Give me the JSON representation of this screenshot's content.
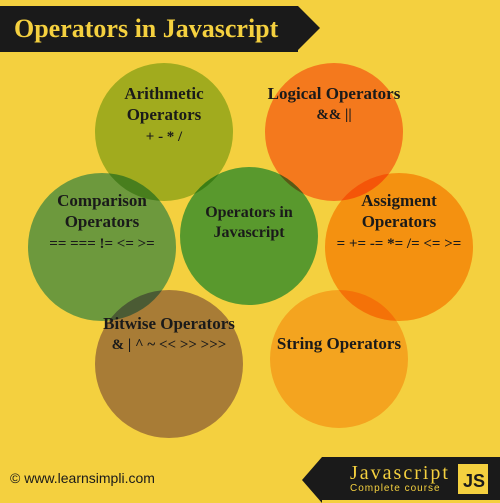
{
  "title": "Operators in Javascript",
  "circles": {
    "arithmetic": {
      "heading": "Arithmetic Operators",
      "ops": "+  -  *  /"
    },
    "logical": {
      "heading": "Logical Operators",
      "ops": "&&  ||"
    },
    "comparison": {
      "heading": "Comparison Operators",
      "ops": "==   ===   !=   <=   >="
    },
    "center": {
      "heading": "Operators in Javascript",
      "ops": ""
    },
    "assignment": {
      "heading": "Assigment Operators",
      "ops": "=   +=   -=   *=  /=  <=  >="
    },
    "bitwise": {
      "heading": "Bitwise Operators",
      "ops": "&  |   ^   ~   <<   >>  >>>"
    },
    "string": {
      "heading": "String Operators",
      "ops": ""
    }
  },
  "footer": {
    "copyright": "© www.learnsimpli.com",
    "brand": "Javascript",
    "tagline": "Complete course",
    "badge": "JS"
  }
}
